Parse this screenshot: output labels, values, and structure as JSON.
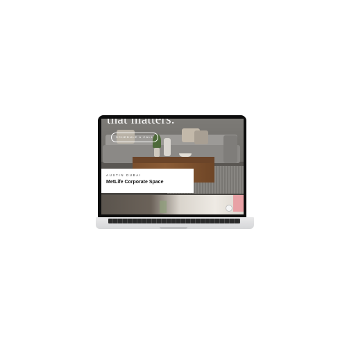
{
  "hero": {
    "title": "that matters.",
    "cta_label": "SCHEDULE A CALL"
  },
  "project_card": {
    "location": "AUSTIN  DUBAI",
    "title": "MetLife Corporate Space"
  },
  "colors": {
    "accent_pink": "#e8a1a5",
    "card_background": "#ffffff",
    "laptop_bezel": "#0d0d0d"
  },
  "icons": {
    "play": "play-icon"
  }
}
